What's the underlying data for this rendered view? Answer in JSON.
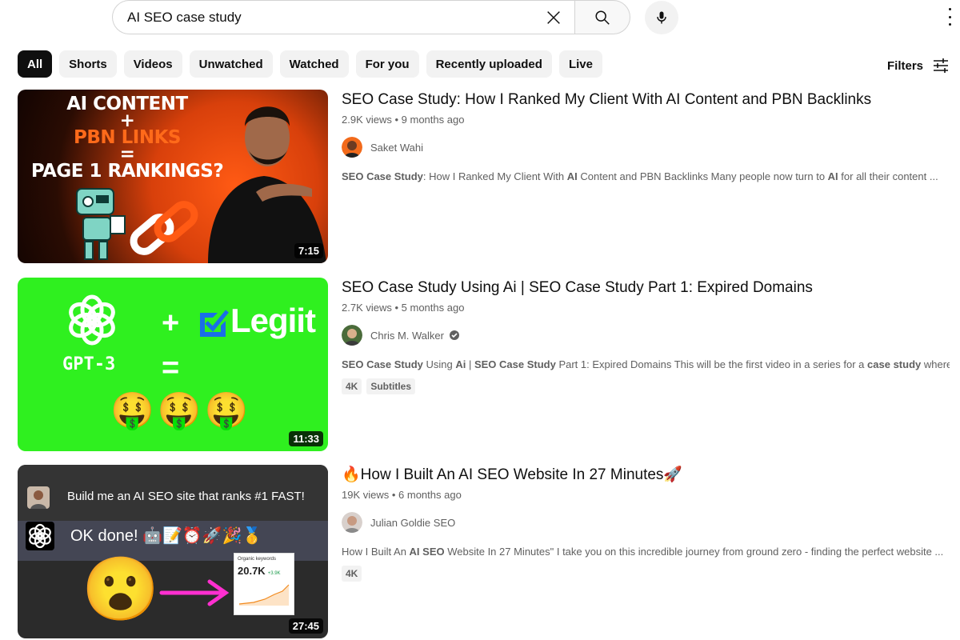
{
  "search": {
    "query": "AI SEO case study",
    "clear_icon": "close-icon",
    "search_icon": "search-icon",
    "mic_icon": "mic-icon"
  },
  "chips": [
    {
      "label": "All",
      "active": true
    },
    {
      "label": "Shorts"
    },
    {
      "label": "Videos"
    },
    {
      "label": "Unwatched"
    },
    {
      "label": "Watched"
    },
    {
      "label": "For you"
    },
    {
      "label": "Recently uploaded"
    },
    {
      "label": "Live"
    }
  ],
  "filters_label": "Filters",
  "results": [
    {
      "title": "SEO Case Study: How I Ranked My Client With AI Content and PBN Backlinks",
      "views": "2.9K views",
      "age": "9 months ago",
      "channel": "Saket Wahi",
      "duration": "7:15",
      "snippet_parts": [
        {
          "text": "SEO Case Study",
          "bold": true
        },
        {
          "text": ": How I Ranked My Client With ",
          "bold": false
        },
        {
          "text": "AI",
          "bold": true
        },
        {
          "text": " Content and PBN Backlinks Many people now turn to ",
          "bold": false
        },
        {
          "text": "AI",
          "bold": true
        },
        {
          "text": " for all their content ...",
          "bold": false
        }
      ],
      "thumb_text": {
        "line1": "AI CONTENT",
        "line2": "+",
        "line3": "PBN LINKS",
        "line4": "=",
        "line5": "PAGE 1 RANKINGS?"
      }
    },
    {
      "title": "SEO Case Study Using Ai | SEO Case Study Part 1: Expired Domains",
      "views": "2.7K views",
      "age": "5 months ago",
      "channel": "Chris M. Walker",
      "verified": true,
      "duration": "11:33",
      "snippet_parts": [
        {
          "text": "SEO Case Study",
          "bold": true
        },
        {
          "text": " Using ",
          "bold": false
        },
        {
          "text": "Ai",
          "bold": true
        },
        {
          "text": " | ",
          "bold": false
        },
        {
          "text": "SEO Case Study",
          "bold": true
        },
        {
          "text": " Part 1: Expired Domains This will be the first video in a series for a ",
          "bold": false
        },
        {
          "text": "case study",
          "bold": true
        },
        {
          "text": " where ...",
          "bold": false
        }
      ],
      "badges": [
        "4K",
        "Subtitles"
      ],
      "thumb_text": {
        "gpt": "GPT-3",
        "plus": "+",
        "eq": "=",
        "brand": "Legiit"
      }
    },
    {
      "title": "🔥How I Built An AI SEO Website In 27 Minutes🚀",
      "views": "19K views",
      "age": "6 months ago",
      "channel": "Julian Goldie SEO",
      "duration": "27:45",
      "snippet_parts": [
        {
          "text": "How I Built An ",
          "bold": false
        },
        {
          "text": "AI SEO",
          "bold": true
        },
        {
          "text": " Website In 27 Minutes\" I take you on this incredible journey from ground zero - finding the perfect website ...",
          "bold": false
        }
      ],
      "badges": [
        "4K"
      ],
      "thumb_text": {
        "prompt": "Build me an AI SEO site that ranks #1 FAST!",
        "reply": "OK done! 🤖📝⏰🚀🎉🥇",
        "card_label": "Organic keywords",
        "card_value": "20.7K",
        "card_delta": "+3.9K"
      }
    }
  ]
}
